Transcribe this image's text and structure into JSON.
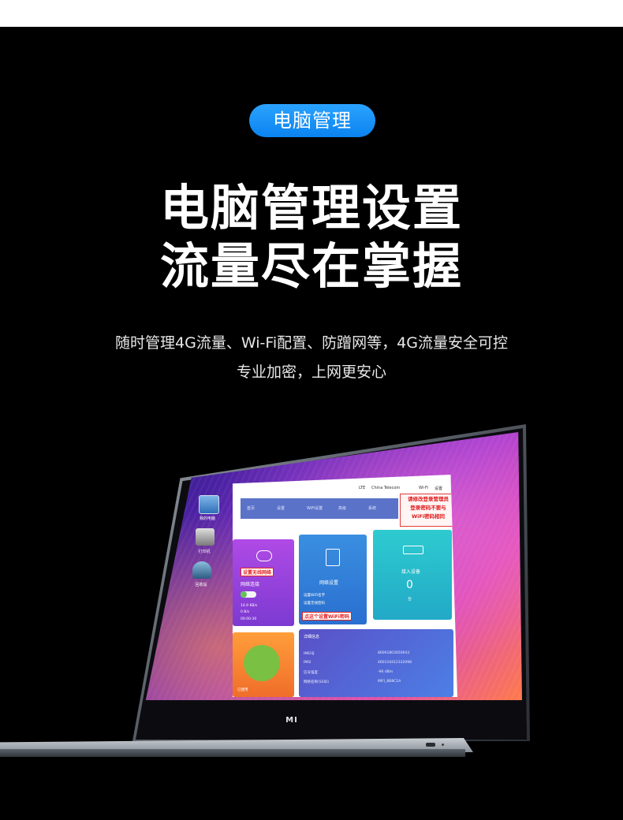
{
  "badge": "电脑管理",
  "headline": {
    "line1": "电脑管理设置",
    "line2": "流量尽在掌握"
  },
  "description": {
    "line1": "随时管理4G流量、Wi-Fi配置、防蹭网等，4G流量安全可控",
    "line2": "专业加密，上网更安心"
  },
  "colors": {
    "badge": "#1a8ff5",
    "background": "#000000",
    "top_strip": "#ffffff"
  },
  "laptop": {
    "brand": "MI",
    "desktop_icons": [
      {
        "label": "我的电脑",
        "icon": "computer-icon"
      },
      {
        "label": "打印机",
        "icon": "printer-icon"
      },
      {
        "label": "回收站",
        "icon": "recycle-bin-icon"
      }
    ],
    "app": {
      "status_bar": [
        "LTE",
        "China Telecom",
        "Wi-Fi",
        "设置"
      ],
      "tabs": [
        "首页",
        "设置",
        "WiFi设置",
        "高级",
        "系统"
      ],
      "warning_lines": [
        "请修改登录管理员",
        "登录密码不要与",
        "WiFi密码相同"
      ],
      "tiles": {
        "network": {
          "title": "网络连接",
          "tag": "设置无线网络",
          "speed_up": "14.9 KB/s",
          "speed_down": "0 B/s",
          "time": "00:00:30"
        },
        "wifi": {
          "title": "网络设置",
          "line1": "设置WiFi名字",
          "line2": "设置无线密码",
          "tag": "点这个设置WiFi密码"
        },
        "devices": {
          "title": "接入设备",
          "count": "0",
          "unit": "台"
        },
        "data": {
          "label": "已使用"
        },
        "info": {
          "header": "详细信息",
          "rows": [
            {
              "k": "IMEI号",
              "v": "86061803050643"
            },
            {
              "k": "IMSI",
              "v": "460110412332098"
            },
            {
              "k": "信号强度",
              "v": "-96 dBm"
            },
            {
              "k": "网络名称(SSID)",
              "v": "MIFI_8B8C1A"
            }
          ]
        }
      }
    }
  }
}
